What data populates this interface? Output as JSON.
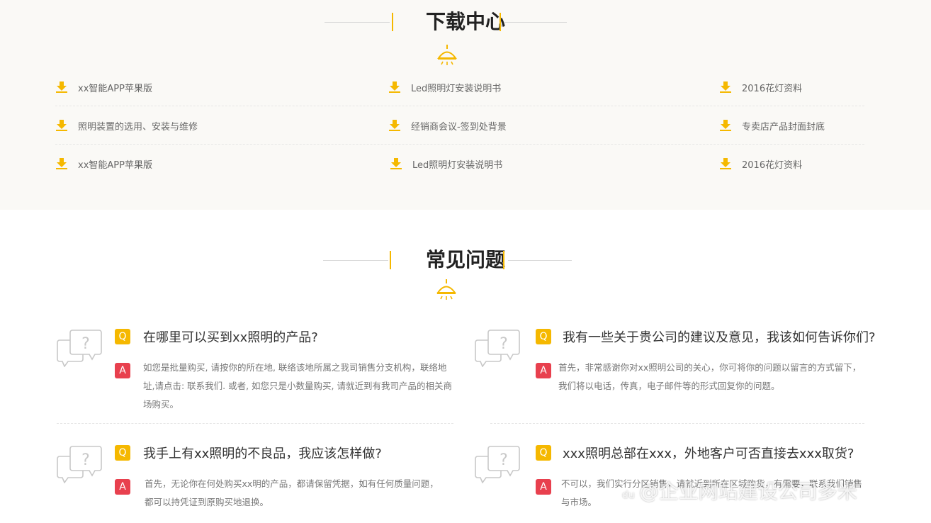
{
  "download": {
    "title": "下载中心",
    "rows": [
      [
        "xx智能APP苹果版",
        "Led照明灯安装说明书",
        "2016花灯资料"
      ],
      [
        "照明装置的选用、安装与维修",
        "经销商会议-签到处背景",
        "专卖店产品封面封底"
      ],
      [
        "xx智能APP苹果版",
        "Led照明灯安装说明书",
        "2016花灯资料"
      ]
    ]
  },
  "faq": {
    "title": "常见问题",
    "q_label": "Q",
    "a_label": "A",
    "items": [
      {
        "q": "在哪里可以买到xx照明的产品?",
        "a": "如您是批量购买, 请按你的所在地, 联络该地所属之我司销售分支机构，联络地址,请点击: 联系我们. 或者, 如您只是小数量购买, 请就近到有我司产品的相关商场购买。"
      },
      {
        "q": "我有一些关于贵公司的建议及意见，我该如何告诉你们?",
        "a": "首先，非常感谢你对xx照明公司的关心，你可将你的问题以留言的方式留下，我们将以电话，传真，电子邮件等的形式回复你的问题。"
      },
      {
        "q": "我手上有xx照明的不良品，我应该怎样做?",
        "a": "首先，无论你在何处购买xx明的产品，都请保留凭据，如有任何质量问题，都可以持凭证到原购买地退换。"
      },
      {
        "q": "xxx照明总部在xxx，外地客户可否直接去xxx取货?",
        "a": "不可以，我们实行分区销售，请就近到所在区域购货，有需要，联系我们销售与市场。"
      }
    ]
  },
  "colors": {
    "accent": "#f5b800",
    "answer": "#e8404e",
    "background_top": "#faf9f6"
  },
  "icons": {
    "download": "download-icon",
    "lamp": "lamp-icon",
    "bubble": "question-bubble-icon"
  },
  "watermark": {
    "prefix": "du",
    "text": "@企业网站建设公司多米"
  }
}
